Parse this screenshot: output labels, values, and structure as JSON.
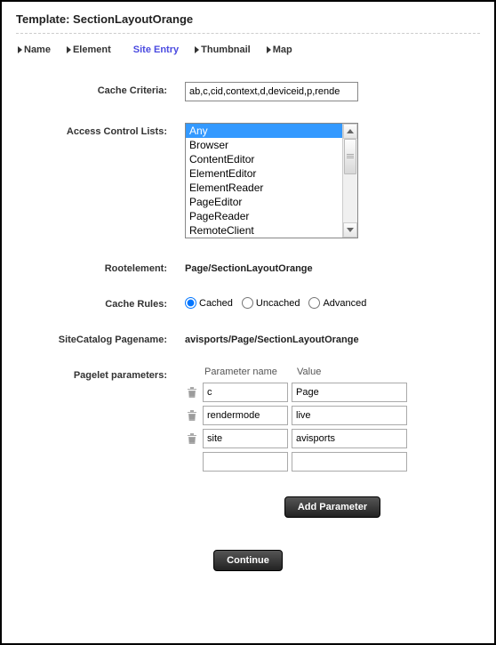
{
  "title": "Template: SectionLayoutOrange",
  "tabs": [
    {
      "label": "Name",
      "active": false
    },
    {
      "label": "Element",
      "active": false
    },
    {
      "label": "Site Entry",
      "active": true
    },
    {
      "label": "Thumbnail",
      "active": false
    },
    {
      "label": "Map",
      "active": false
    }
  ],
  "form": {
    "cache_criteria": {
      "label": "Cache Criteria:",
      "value": "ab,c,cid,context,d,deviceid,p,rende"
    },
    "acl": {
      "label": "Access Control Lists:",
      "options": [
        "Any",
        "Browser",
        "ContentEditor",
        "ElementEditor",
        "ElementReader",
        "PageEditor",
        "PageReader",
        "RemoteClient"
      ],
      "selected": "Any"
    },
    "rootelement": {
      "label": "Rootelement:",
      "value": "Page/SectionLayoutOrange"
    },
    "cache_rules": {
      "label": "Cache Rules:",
      "options": [
        {
          "label": "Cached",
          "checked": true
        },
        {
          "label": "Uncached",
          "checked": false
        },
        {
          "label": "Advanced",
          "checked": false
        }
      ]
    },
    "sitecatalog": {
      "label": "SiteCatalog Pagename:",
      "value": "avisports/Page/SectionLayoutOrange"
    },
    "pagelet": {
      "label": "Pagelet parameters:",
      "header_name": "Parameter name",
      "header_value": "Value",
      "rows": [
        {
          "name": "c",
          "value": "Page",
          "has_trash": true
        },
        {
          "name": "rendermode",
          "value": "live",
          "has_trash": true
        },
        {
          "name": "site",
          "value": "avisports",
          "has_trash": true
        },
        {
          "name": "",
          "value": "",
          "has_trash": false
        }
      ]
    }
  },
  "buttons": {
    "add_parameter": "Add Parameter",
    "continue": "Continue"
  }
}
